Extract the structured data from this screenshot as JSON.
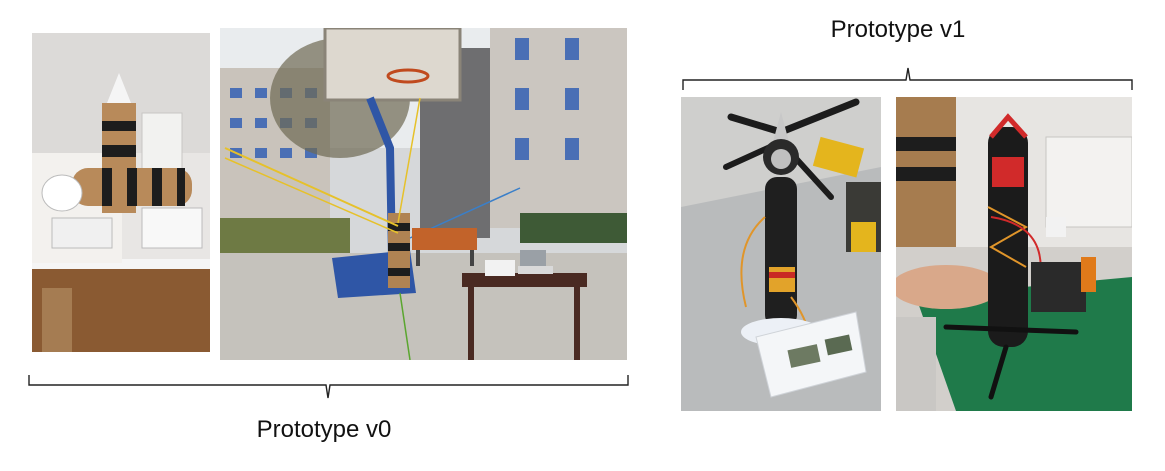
{
  "captions": {
    "v1": "Prototype v1",
    "v0": "Prototype v0"
  },
  "figures": [
    {
      "name": "photo-tube-on-table"
    },
    {
      "name": "photo-outdoor-tether-test"
    },
    {
      "name": "photo-prototype-on-scale"
    },
    {
      "name": "photo-prototype-handheld"
    }
  ]
}
